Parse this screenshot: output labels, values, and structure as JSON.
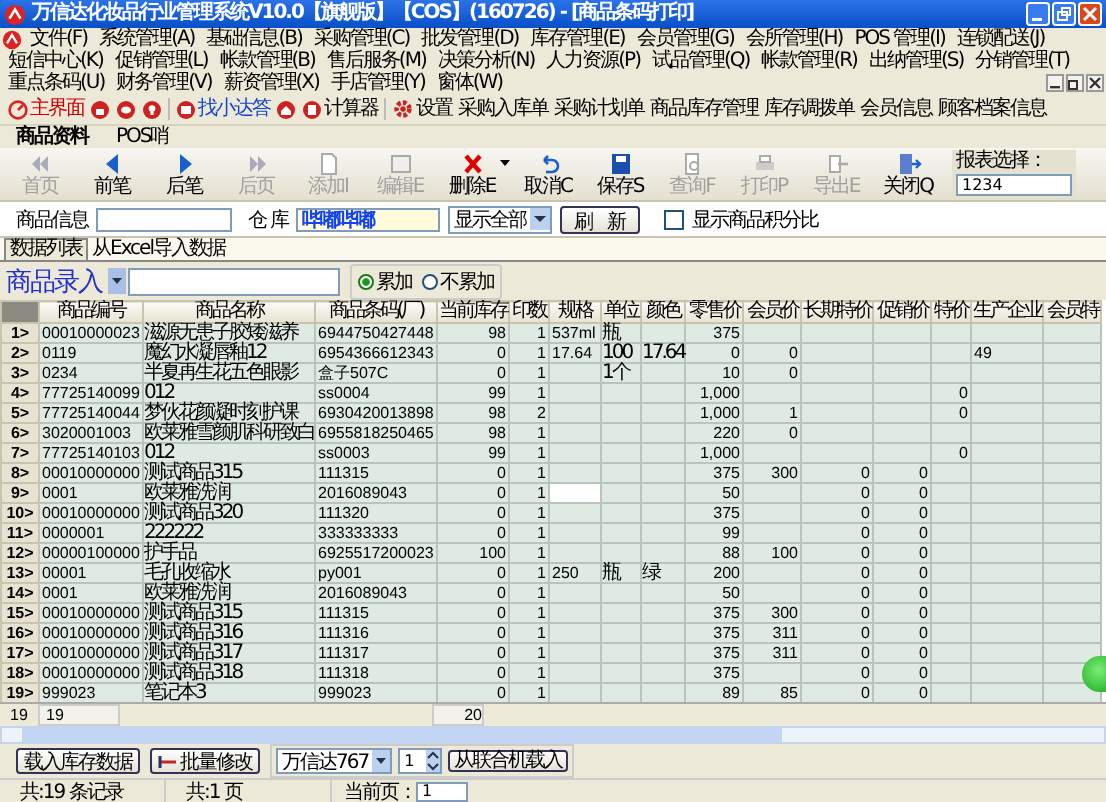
{
  "window": {
    "title": "万信达化妆品行业管理系统V10.0【旗舰版】【COS】(160726) - [商品条码打印]"
  },
  "menu": [
    "文件(F)",
    "系统管理(A)",
    "基础信息(B)",
    "采购管理(C)",
    "批发管理(D)",
    "库存管理(E)",
    "会员管理(G)",
    "会所管理(H)",
    "POS 管理(I)",
    "连锁配送(J)",
    "短信中心(K)",
    "促销管理(L)",
    "帐款管理(B)",
    "售后服务(M)",
    "决策分析(N)",
    "人力资源(P)",
    "试品管理(Q)",
    "帐款管理(R)",
    "出纳管理(S)",
    "分销管理(T)",
    "重点条码(U)",
    "财务管理(V)",
    "薪资管理(X)",
    "手店管理(Y)",
    "窗体(W)"
  ],
  "quick_bar": [
    {
      "label": "主界面"
    },
    {
      "label": "找小达答"
    },
    {
      "label": "计算器"
    },
    {
      "label": "设置"
    },
    {
      "label": "采购入库单"
    },
    {
      "label": "采购计划单"
    },
    {
      "label": "商品库存管理"
    },
    {
      "label": "库存调拨单"
    },
    {
      "label": "会员信息"
    },
    {
      "label": "顾客档案信息"
    }
  ],
  "module_tabs": [
    {
      "label": "商品资料",
      "selected": true
    },
    {
      "label": "POS哨",
      "selected": false
    }
  ],
  "toolbar": [
    {
      "label": "首页",
      "disabled": true
    },
    {
      "label": "前笔",
      "disabled": false
    },
    {
      "label": "后笔",
      "disabled": false
    },
    {
      "label": "后页",
      "disabled": true
    },
    {
      "label": "添加I",
      "disabled": true
    },
    {
      "label": "编辑E",
      "disabled": true
    },
    {
      "label": "删除E",
      "disabled": false
    },
    {
      "label": "取消C",
      "disabled": false
    },
    {
      "label": "保存S",
      "disabled": false
    },
    {
      "label": "查询F",
      "disabled": true
    },
    {
      "label": "打印P",
      "disabled": true
    },
    {
      "label": "导出E",
      "disabled": true
    },
    {
      "label": "关闭Q",
      "disabled": false
    }
  ],
  "report_select": {
    "label": "报表选择：",
    "value": "1234"
  },
  "filter": {
    "info_label": "商品信息",
    "warehouse_label": "仓  库",
    "warehouse_value": "哔嘟哔嘟",
    "show_select": "显示全部",
    "refresh": "刷  新",
    "points_label": "显示商品积分比",
    "points_checked": false
  },
  "data_tabs": [
    {
      "label": "数据列表",
      "selected": true
    },
    {
      "label": "从Excel导入数据",
      "selected": false
    }
  ],
  "entry": {
    "label": "商品录入",
    "options": [
      {
        "label": "累加",
        "selected": true
      },
      {
        "label": "不累加",
        "selected": false
      }
    ]
  },
  "table": {
    "columns": [
      "商品编号",
      "商品名称",
      "商品条码(厂)",
      "当前库存",
      "印数",
      "规格",
      "单位",
      "颜色",
      "零售价",
      "会员价",
      "长期特价",
      "促销价",
      "特价",
      "生产企业",
      "会员特"
    ],
    "rows": [
      {
        "number": "1>",
        "cells": [
          "00010000023",
          "滋源无患子胶矮滋养",
          "6944750427448",
          "98",
          "1",
          "537ml",
          "瓶",
          "",
          "375",
          "",
          "",
          "",
          "",
          "",
          ""
        ]
      },
      {
        "number": "2>",
        "cells": [
          "0119",
          "魔幻水凝唇釉12",
          "6954366612343",
          "0",
          "1",
          "17.64",
          "100",
          "17.64",
          "0",
          "0",
          "",
          "",
          "",
          "49",
          ""
        ]
      },
      {
        "number": "3>",
        "cells": [
          "0234",
          "半夏再生花五色眼影",
          "盒子507C",
          "0",
          "1",
          "",
          "1个",
          "",
          "10",
          "0",
          "",
          "",
          "",
          "",
          ""
        ]
      },
      {
        "number": "4>",
        "cells": [
          "77725140099",
          "012",
          "ss0004",
          "99",
          "1",
          "",
          "",
          "",
          "1,000",
          "",
          "",
          "",
          "0",
          "",
          ""
        ]
      },
      {
        "number": "5>",
        "cells": [
          "77725140044",
          "梦伙花颜凝时刻护课",
          "6930420013898",
          "98",
          "2",
          "",
          "",
          "",
          "1,000",
          "1",
          "",
          "",
          "0",
          "",
          ""
        ]
      },
      {
        "number": "6>",
        "cells": [
          "3020001003",
          "欧莱雅雪颜肌科研致白",
          "6955818250465",
          "98",
          "1",
          "",
          "",
          "",
          "220",
          "0",
          "",
          "",
          "",
          "",
          ""
        ]
      },
      {
        "number": "7>",
        "cells": [
          "77725140103",
          "012",
          "ss0003",
          "99",
          "1",
          "",
          "",
          "",
          "1,000",
          "",
          "",
          "",
          "0",
          "",
          ""
        ]
      },
      {
        "number": "8>",
        "cells": [
          "00010000000",
          "测试商品315",
          "111315",
          "0",
          "1",
          "",
          "",
          "",
          "375",
          "300",
          "0",
          "0",
          "",
          "",
          ""
        ]
      },
      {
        "number": "9>",
        "cells": [
          "0001",
          "欧莱雅洗润",
          "2016089043",
          "0",
          "1",
          "",
          "",
          "",
          "50",
          "",
          "0",
          "0",
          "",
          "",
          ""
        ]
      },
      {
        "number": "10>",
        "cells": [
          "00010000000",
          "测试商品320",
          "111320",
          "0",
          "1",
          "",
          "",
          "",
          "375",
          "",
          "0",
          "0",
          "",
          "",
          ""
        ]
      },
      {
        "number": "11>",
        "cells": [
          "0000001",
          "222222",
          "333333333",
          "0",
          "1",
          "",
          "",
          "",
          "99",
          "",
          "0",
          "0",
          "",
          "",
          ""
        ]
      },
      {
        "number": "12>",
        "cells": [
          "00000100000",
          "护手品",
          "6925517200023",
          "100",
          "1",
          "",
          "",
          "",
          "88",
          "100",
          "0",
          "0",
          "",
          "",
          ""
        ]
      },
      {
        "number": "13>",
        "cells": [
          "00001",
          "毛孔收缩水",
          "py001",
          "0",
          "1",
          "250",
          "瓶",
          "绿",
          "200",
          "",
          "0",
          "0",
          "",
          "",
          ""
        ]
      },
      {
        "number": "14>",
        "cells": [
          "0001",
          "欧莱雅洗润",
          "2016089043",
          "0",
          "1",
          "",
          "",
          "",
          "50",
          "",
          "0",
          "0",
          "",
          "",
          ""
        ]
      },
      {
        "number": "15>",
        "cells": [
          "00010000000",
          "测试商品315",
          "111315",
          "0",
          "1",
          "",
          "",
          "",
          "375",
          "300",
          "0",
          "0",
          "",
          "",
          ""
        ]
      },
      {
        "number": "16>",
        "cells": [
          "00010000000",
          "测试商品316",
          "111316",
          "0",
          "1",
          "",
          "",
          "",
          "375",
          "311",
          "0",
          "0",
          "",
          "",
          ""
        ]
      },
      {
        "number": "17>",
        "cells": [
          "00010000000",
          "测试商品317",
          "111317",
          "0",
          "1",
          "",
          "",
          "",
          "375",
          "311",
          "0",
          "0",
          "",
          "",
          ""
        ]
      },
      {
        "number": "18>",
        "cells": [
          "00010000000",
          "测试商品318",
          "111318",
          "0",
          "1",
          "",
          "",
          "",
          "375",
          "",
          "0",
          "0",
          "",
          "",
          ""
        ]
      },
      {
        "number": "19>",
        "cells": [
          "999023",
          "笔记本3",
          "999023",
          "0",
          "1",
          "",
          "",
          "",
          "89",
          "85",
          "0",
          "0",
          "",
          "",
          ""
        ]
      }
    ],
    "footer": {
      "count": "19",
      "code_total": "19",
      "stock_total": "20"
    }
  },
  "actions": {
    "load": "载入库存数据",
    "batch": "批量修改",
    "device": "万信达767",
    "spin": "1",
    "import": "从联合机载入"
  },
  "status_bar": {
    "records": "共:19 条记录",
    "pages": "共:1 页",
    "current_label": "当前页：",
    "current_value": "1"
  }
}
